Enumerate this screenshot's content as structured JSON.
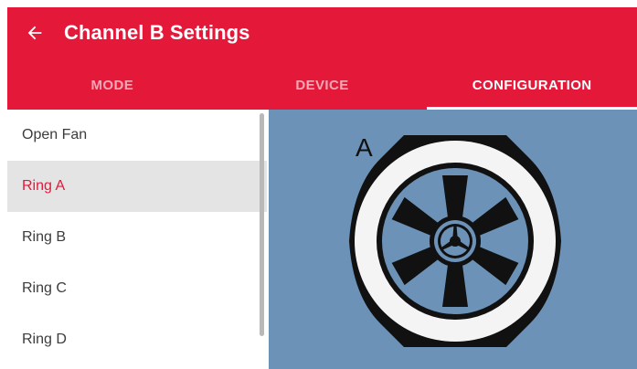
{
  "header": {
    "title": "Channel B Settings",
    "back_icon": "arrow-left-icon",
    "background_color": "#e4193a"
  },
  "tabs": [
    {
      "label": "MODE",
      "active": false
    },
    {
      "label": "DEVICE",
      "active": false
    },
    {
      "label": "CONFIGURATION",
      "active": true
    }
  ],
  "list": {
    "items": [
      {
        "label": "Open Fan",
        "selected": false
      },
      {
        "label": "Ring A",
        "selected": true
      },
      {
        "label": "Ring B",
        "selected": false
      },
      {
        "label": "Ring C",
        "selected": false
      },
      {
        "label": "Ring D",
        "selected": false
      }
    ]
  },
  "preview": {
    "label": "A",
    "background_color": "#6c92b8"
  }
}
